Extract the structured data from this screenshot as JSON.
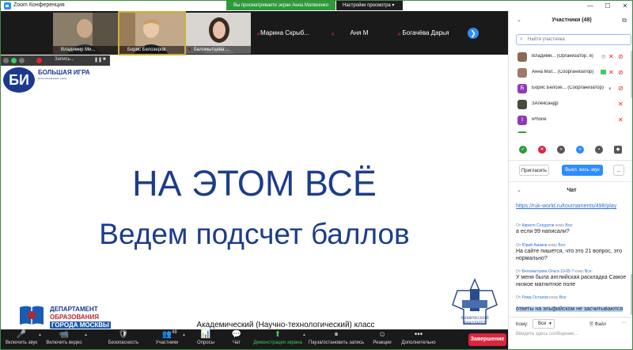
{
  "window": {
    "title": "Zoom Конференция",
    "banner": "Вы просматриваете экран Анна Матвеенко",
    "view_options": "Настройки просмотра ▾",
    "minimize": "—",
    "maximize": "☐",
    "close": "✕"
  },
  "thumbnails": [
    {
      "name": "Владимир Ми...",
      "muted": true
    },
    {
      "name": "Борис Белозеров",
      "muted": false
    },
    {
      "name": "Беломытцева ...",
      "muted": true
    },
    {
      "name": "Марина  Скрыб...",
      "muted": true
    },
    {
      "name": "Аня М",
      "muted": true
    },
    {
      "name": "Богачёва Дарья",
      "muted": true
    }
  ],
  "next_arrow": "❯",
  "recording": {
    "label": "Запись...",
    "pause": "❚❚",
    "stop": "■"
  },
  "slide": {
    "logo_mark": "БИ",
    "logo_title": "БОЛЬШАЯ ИГРА",
    "logo_subtitle": "интеллектуальный турнир",
    "title": "НА ЭТОМ ВСЁ",
    "subtitle": "Ведем подсчет баллов",
    "footer": "Академический (Научно-технологический) класс",
    "dept_lines": [
      "ДЕПАРТАМЕНТ",
      "ОБРАЗОВАНИЯ",
      "ГОРОДА МОСКВЫ"
    ],
    "chem_text": [
      "ХИМИЧЕСКИЙ",
      "ФАКУЛЬТЕТ"
    ],
    "colors": {
      "title": "#1c3d8a",
      "dept_red": "#b5282a",
      "dept_blue": "#1b5cb3"
    }
  },
  "toolbar": {
    "items": [
      {
        "label": "Включить звук",
        "icon": "🎤"
      },
      {
        "label": "Включить видео",
        "icon": "📹"
      },
      {
        "label": "Безопасность",
        "icon": "🛡"
      },
      {
        "label": "Участники",
        "icon": "👥",
        "count": "48"
      },
      {
        "label": "Опросы",
        "icon": "📊"
      },
      {
        "label": "Чат",
        "icon": "💬"
      },
      {
        "label": "Демонстрация экрана",
        "icon": "⬆"
      },
      {
        "label": "Пауза/остановить запись",
        "icon": "⏸"
      },
      {
        "label": "Реакции",
        "icon": "☺"
      },
      {
        "label": "Дополнительно",
        "icon": "•••"
      }
    ],
    "end": "Завершение"
  },
  "participants": {
    "title": "Участники (48)",
    "search_placeholder": "Найти участника",
    "rows": [
      {
        "name": "Владими... (Организатор, я)",
        "avatar": "",
        "avatar_color": "#8a6a52"
      },
      {
        "name": "Анна Мат... (Соорганизатор)",
        "avatar": "",
        "avatar_color": "#a0786a"
      },
      {
        "name": "Борис Белозе... (Соорганизатор)",
        "avatar": "Б",
        "avatar_color": "#8e3ab8"
      },
      {
        "name": "ЗАлександр",
        "avatar": "",
        "avatar_color": "#4a4a3a"
      },
      {
        "name": "iPhone",
        "avatar": "I",
        "avatar_color": "#8e3ab8"
      },
      {
        "name": "",
        "avatar": "",
        "avatar_color": "#2e9a3a"
      }
    ],
    "invite": "Пригласить",
    "mute_all": "Выкл. весь звук",
    "more": "..."
  },
  "chat": {
    "title": "Чат",
    "messages": [
      {
        "from": "",
        "to": "",
        "text": "https://ruk-world.ru/tournaments/498/play",
        "link": true
      },
      {
        "from": "Кирилл Солдатов",
        "to": "Все:",
        "text": "а если 99 написали?"
      },
      {
        "from": "Юрий Акимов",
        "to": "Все:",
        "text": "На сайте пишется, что это 21 вопрос, это нормально?"
      },
      {
        "from": "Беломытцева Ольга 10-05 !!",
        "to": "Все:",
        "text": "У меня была английская раскладка Самое низкое магнитное поле"
      },
      {
        "from": "Рома Осталов",
        "to": "Все:",
        "text": "ответы на эльфийском не засчитываются",
        "selected": true
      }
    ],
    "from_word": "От",
    "to_word": "кому",
    "to_label": "Кому:",
    "to_value": "Все",
    "file": "Файл",
    "placeholder": "Введите здесь сообщение..."
  }
}
